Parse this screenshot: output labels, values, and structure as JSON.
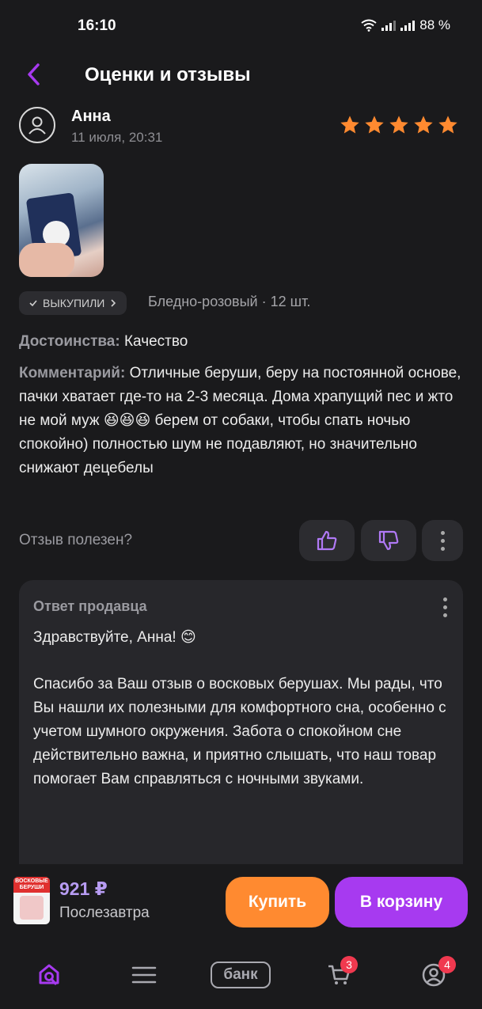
{
  "status_bar": {
    "time": "16:10",
    "battery": "88 %"
  },
  "header": {
    "title": "Оценки и отзывы"
  },
  "review": {
    "author": "Анна",
    "date": "11 июля, 20:31",
    "rating": 5,
    "purchased_badge": "ВЫКУПИЛИ",
    "variant": "Бледно-розовый · 12 шт.",
    "advantages_label": "Достоинства:",
    "advantages": "Качество",
    "comment_label": "Комментарий:",
    "comment": "Отличные беруши, беру на постоянной основе, пачки хватает где-то на 2-3 месяца. Дома храпущий пес и жто не мой муж 😆😆😆 берем от собаки, чтобы спать ночью спокойно) полностью шум не подавляют, но значительно снижают децебелы",
    "helpful_question": "Отзыв полезен?"
  },
  "seller_reply": {
    "title": "Ответ продавца",
    "greeting": "Здравствуйте, Анна! 😊",
    "body": "Спасибо за Ваш отзыв о восковых берушах. Мы рады, что Вы нашли их полезными для комфортного сна, особенно с учетом шумного окружения. Забота о спокойном сне действительно важна, и приятно слышать, что наш товар помогает Вам справляться с ночными звуками."
  },
  "product_bar": {
    "thumb_text": "ВОСКОВЫЕ БЕРУШИ",
    "price": "921 ₽",
    "delivery": "Послезавтра",
    "buy_label": "Купить",
    "cart_label": "В корзину"
  },
  "bottom_nav": {
    "bank_label": "банк",
    "cart_badge": "3",
    "profile_badge": "4"
  },
  "colors": {
    "accent_purple": "#a73af0",
    "accent_orange": "#ff8a30",
    "star": "#ff8a30",
    "badge": "#f0394f"
  },
  "icons": [
    "back-arrow-icon",
    "user-avatar-icon",
    "star-icon",
    "check-icon",
    "chevron-right-icon",
    "thumbs-up-icon",
    "thumbs-down-icon",
    "more-vertical-icon",
    "home-search-icon",
    "catalog-icon",
    "cart-icon",
    "profile-icon"
  ]
}
